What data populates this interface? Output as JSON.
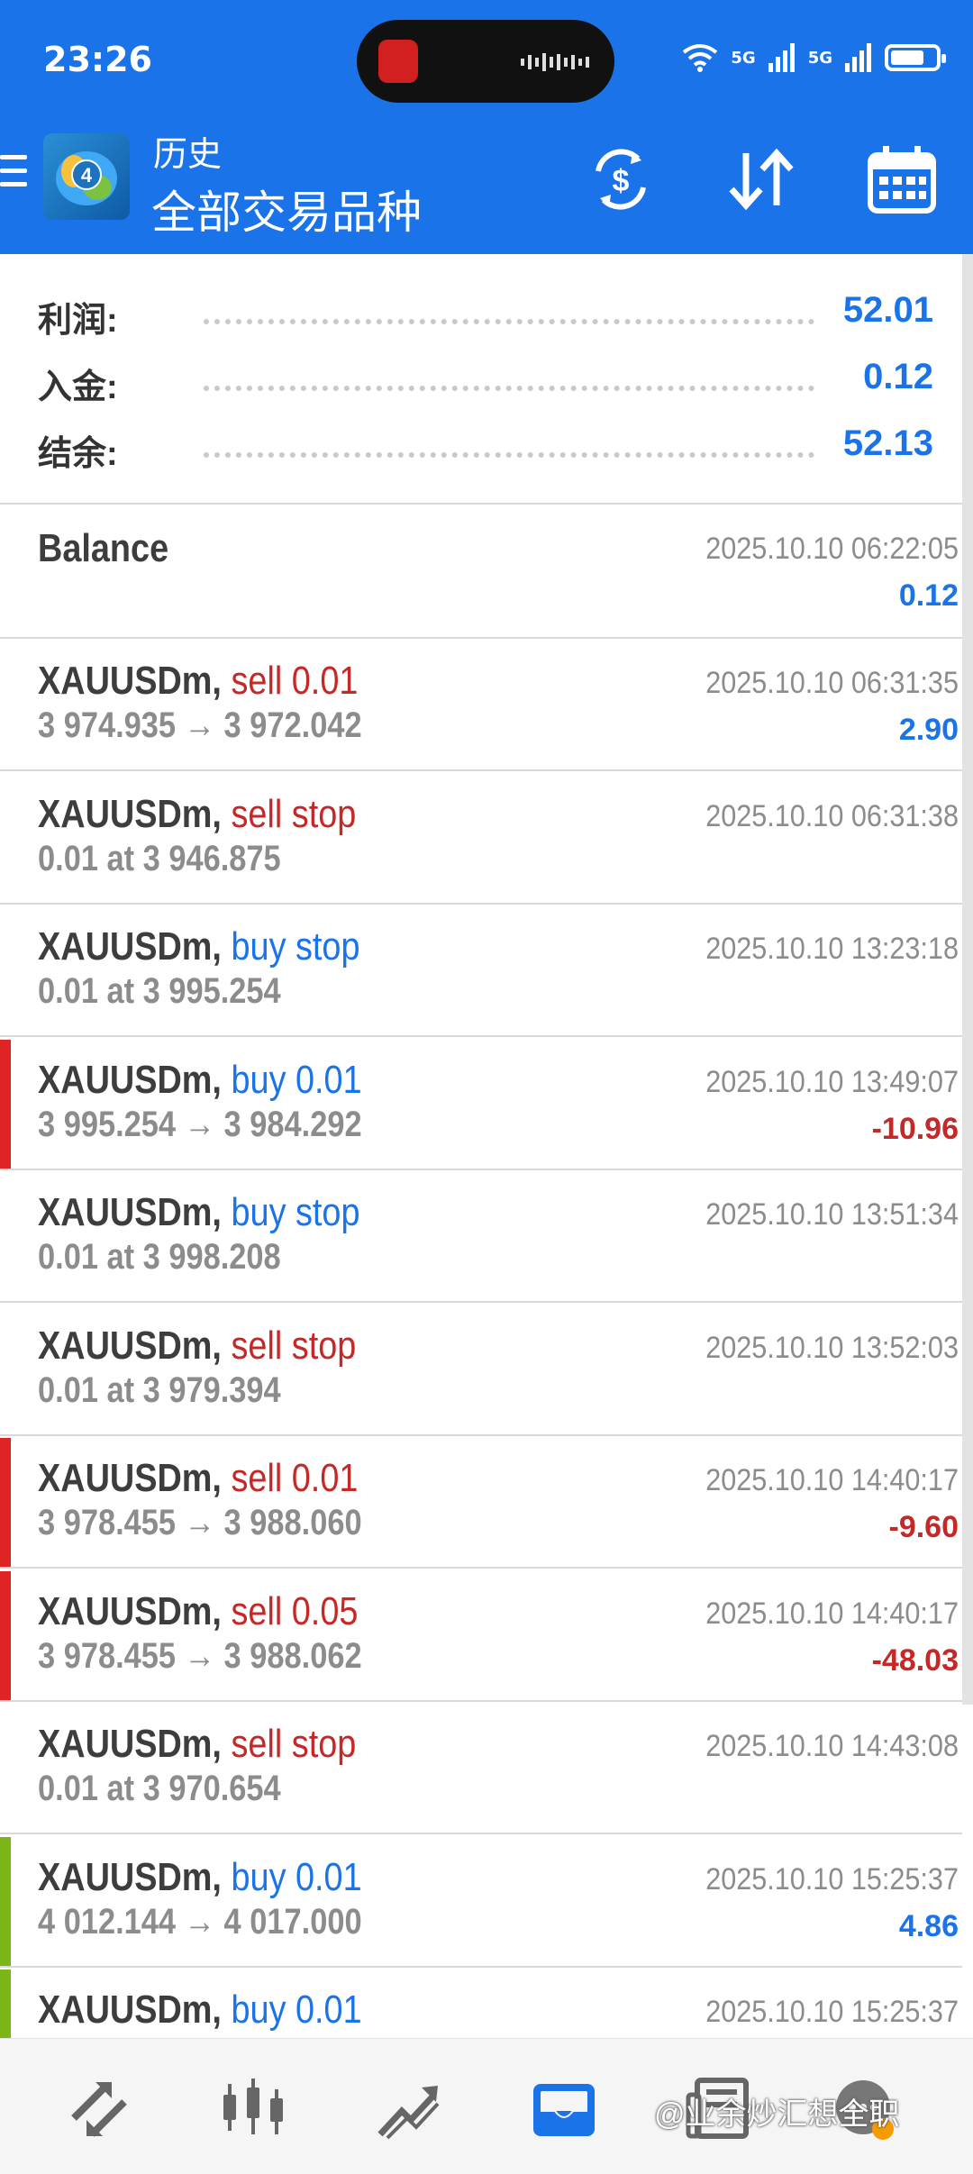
{
  "status_bar": {
    "time": "23:26",
    "signal_1": "5G",
    "signal_2": "5G"
  },
  "header": {
    "title": "历史",
    "subtitle": "全部交易品种"
  },
  "summary": [
    {
      "label": "利润:",
      "value": "52.01"
    },
    {
      "label": "入金:",
      "value": "0.12"
    },
    {
      "label": "结余:",
      "value": "52.13"
    }
  ],
  "balance": {
    "label": "Balance",
    "time": "2025.10.10 06:22:05",
    "amount": "0.12"
  },
  "deals": [
    {
      "symbol": "XAUUSDm,",
      "action": "sell 0.01",
      "side": "sell",
      "price": "3 974.935 → 3 972.042",
      "time": "2025.10.10 06:31:35",
      "profit": "2.90",
      "profit_sign": "pos",
      "marker": ""
    },
    {
      "symbol": "XAUUSDm,",
      "action": "sell stop",
      "side": "sell",
      "price": "0.01 at 3 946.875",
      "time": "2025.10.10 06:31:38",
      "profit": "",
      "profit_sign": "",
      "marker": ""
    },
    {
      "symbol": "XAUUSDm,",
      "action": "buy stop",
      "side": "buy",
      "price": "0.01 at 3 995.254",
      "time": "2025.10.10 13:23:18",
      "profit": "",
      "profit_sign": "",
      "marker": ""
    },
    {
      "symbol": "XAUUSDm,",
      "action": "buy 0.01",
      "side": "buy",
      "price": "3 995.254 → 3 984.292",
      "time": "2025.10.10 13:49:07",
      "profit": "-10.96",
      "profit_sign": "neg",
      "marker": "#e02424"
    },
    {
      "symbol": "XAUUSDm,",
      "action": "buy stop",
      "side": "buy",
      "price": "0.01 at 3 998.208",
      "time": "2025.10.10 13:51:34",
      "profit": "",
      "profit_sign": "",
      "marker": ""
    },
    {
      "symbol": "XAUUSDm,",
      "action": "sell stop",
      "side": "sell",
      "price": "0.01 at 3 979.394",
      "time": "2025.10.10 13:52:03",
      "profit": "",
      "profit_sign": "",
      "marker": ""
    },
    {
      "symbol": "XAUUSDm,",
      "action": "sell 0.01",
      "side": "sell",
      "price": "3 978.455 → 3 988.060",
      "time": "2025.10.10 14:40:17",
      "profit": "-9.60",
      "profit_sign": "neg",
      "marker": "#e02424"
    },
    {
      "symbol": "XAUUSDm,",
      "action": "sell 0.05",
      "side": "sell",
      "price": "3 978.455 → 3 988.062",
      "time": "2025.10.10 14:40:17",
      "profit": "-48.03",
      "profit_sign": "neg",
      "marker": "#e02424"
    },
    {
      "symbol": "XAUUSDm,",
      "action": "sell stop",
      "side": "sell",
      "price": "0.01 at 3 970.654",
      "time": "2025.10.10 14:43:08",
      "profit": "",
      "profit_sign": "",
      "marker": ""
    },
    {
      "symbol": "XAUUSDm,",
      "action": "buy 0.01",
      "side": "buy",
      "price": "4 012.144 → 4 017.000",
      "time": "2025.10.10 15:25:37",
      "profit": "4.86",
      "profit_sign": "pos",
      "marker": "#7cb518"
    },
    {
      "symbol": "XAUUSDm,",
      "action": "buy 0.01",
      "side": "buy",
      "price": "",
      "time": "2025.10.10 15:25:37",
      "profit": "",
      "profit_sign": "",
      "marker": "#7cb518"
    }
  ],
  "bottom_nav": [
    {
      "name": "quotes-icon"
    },
    {
      "name": "chart-icon"
    },
    {
      "name": "trade-icon"
    },
    {
      "name": "history-icon",
      "active": true
    },
    {
      "name": "news-icon"
    },
    {
      "name": "chat-icon"
    }
  ],
  "watermark": "@业余炒汇想全职",
  "colors": {
    "primary": "#1a73e8",
    "sell": "#c62828",
    "loss_marker": "#e02424",
    "profit_marker": "#7cb518"
  }
}
